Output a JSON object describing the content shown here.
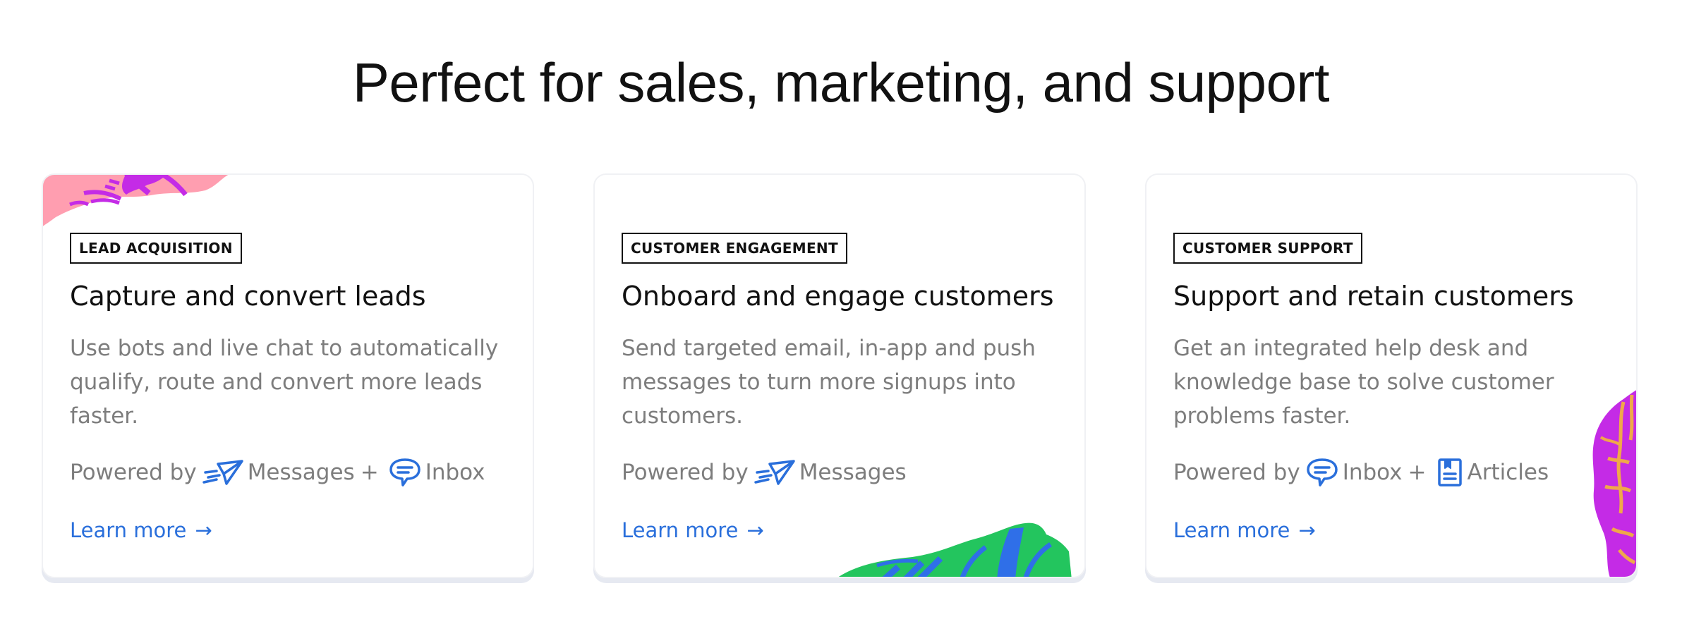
{
  "page": {
    "title": "Perfect for sales, marketing, and support"
  },
  "colors": {
    "link": "#2a6fdb",
    "muted_text": "#7d7d7d",
    "blob_pink": "#ff9eb0",
    "blob_purple": "#c42be6",
    "blob_green": "#23c55e",
    "blob_blue": "#2f6fe8",
    "blob_orange": "#f0a84a"
  },
  "cards": [
    {
      "tag": "LEAD ACQUISITION",
      "title": "Capture and convert leads",
      "description": "Use bots and live chat to automatically qualify, route and convert more leads faster.",
      "powered_by_label": "Powered by",
      "products": [
        {
          "icon": "messages-icon",
          "label": "Messages"
        },
        {
          "icon": "inbox-icon",
          "label": "Inbox"
        }
      ],
      "link_text": "Learn more"
    },
    {
      "tag": "CUSTOMER ENGAGEMENT",
      "title": "Onboard and engage customers",
      "description": "Send targeted email, in-app and push messages to turn more signups into customers.",
      "powered_by_label": "Powered by",
      "products": [
        {
          "icon": "messages-icon",
          "label": "Messages"
        }
      ],
      "link_text": "Learn more"
    },
    {
      "tag": "CUSTOMER SUPPORT",
      "title": "Support and retain customers",
      "description": "Get an integrated help desk and knowledge base to solve customer problems faster.",
      "powered_by_label": "Powered by",
      "products": [
        {
          "icon": "inbox-icon",
          "label": "Inbox"
        },
        {
          "icon": "articles-icon",
          "label": "Articles"
        }
      ],
      "link_text": "Learn more"
    }
  ],
  "plus_sign": "+",
  "arrow_glyph": "→"
}
